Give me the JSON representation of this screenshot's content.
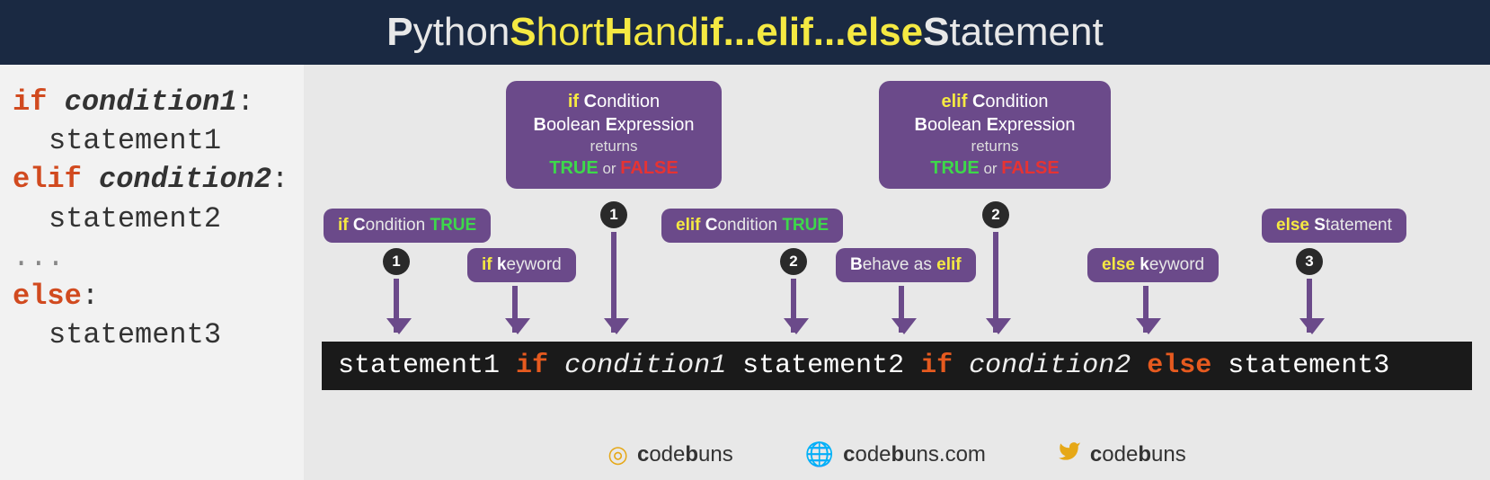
{
  "header": {
    "p_cap": "P",
    "python": "ython ",
    "s_cap": "S",
    "shorthand": "hort",
    "h_cap": "H",
    "hand": "and ",
    "if_elif_else": "if...elif...else ",
    "s2_cap": "S",
    "statement": "tatement"
  },
  "code": {
    "l1_kw": "if",
    "l1_cond": "condition1",
    "l1_colon": ":",
    "l2": "statement1",
    "l3_kw": "elif",
    "l3_cond": "condition2",
    "l3_colon": ":",
    "l4": "statement2",
    "l5": "...",
    "l6_kw": "else",
    "l6_colon": ":",
    "l7": "statement3"
  },
  "callouts": {
    "big1": {
      "kw": "if",
      "c_cap": "C",
      "condition": "ondition",
      "b_cap": "B",
      "boolean": "oolean ",
      "e_cap": "E",
      "expression": "xpression",
      "returns": "returns",
      "true": "TRUE",
      "or": " or ",
      "false": "FALSE"
    },
    "big2": {
      "kw": "elif",
      "c_cap": "C",
      "condition": "ondition",
      "b_cap": "B",
      "boolean": "oolean ",
      "e_cap": "E",
      "expression": "xpression",
      "returns": "returns",
      "true": "TRUE",
      "or": " or ",
      "false": "FALSE"
    },
    "small1": {
      "kw": "if",
      "c_cap": "C",
      "text": "ondition ",
      "true": "TRUE"
    },
    "small2": {
      "kw": "if",
      "k_cap": "k",
      "text": "eyword"
    },
    "small3": {
      "kw": "elif",
      "c_cap": "C",
      "text": "ondition ",
      "true": "TRUE"
    },
    "small4": {
      "b_cap": "B",
      "text": "ehave as ",
      "kw": "elif"
    },
    "small5": {
      "kw": "else",
      "k_cap": "k",
      "text": "eyword"
    },
    "small6": {
      "kw": "else",
      "s_cap": "S",
      "text": "tatement"
    }
  },
  "badges": {
    "b1": "1",
    "b2": "2",
    "b3": "3",
    "big1_badge": "1",
    "big2_badge": "2"
  },
  "strip": {
    "s1": "statement1 ",
    "kw1": "if ",
    "c1": "condition1 ",
    "s2": "statement2 ",
    "kw2": "if ",
    "c2": "condition2 ",
    "kw3": "else ",
    "s3": "statement3"
  },
  "footer": {
    "brand_c": "c",
    "brand_ode": "ode",
    "brand_b": "b",
    "brand_uns": "uns",
    "brand_com": ".com"
  }
}
